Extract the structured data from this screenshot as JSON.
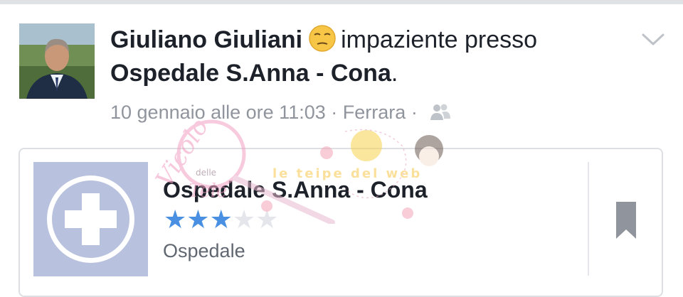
{
  "post": {
    "author": "Giuliano Giuliani",
    "feeling_icon": "unamused-face-icon",
    "feeling": "impaziente presso",
    "place": "Ospedale S.Anna - Cona",
    "place_suffix": ".",
    "date": "10 gennaio alle ore 11:03",
    "separator": "·",
    "location": "Ferrara",
    "audience_icon": "friends-icon"
  },
  "card": {
    "title": "Ospedale S.Anna - Cona",
    "rating": 3,
    "rating_max": 5,
    "category": "Ospedale",
    "image_icon": "hospital-cross-icon",
    "save_icon": "bookmark-icon",
    "accent": "#4a90e2"
  },
  "watermark": {
    "line1": "Vicolo",
    "line2": "delle",
    "line3": "Tele",
    "text2": "le teipe del web"
  }
}
